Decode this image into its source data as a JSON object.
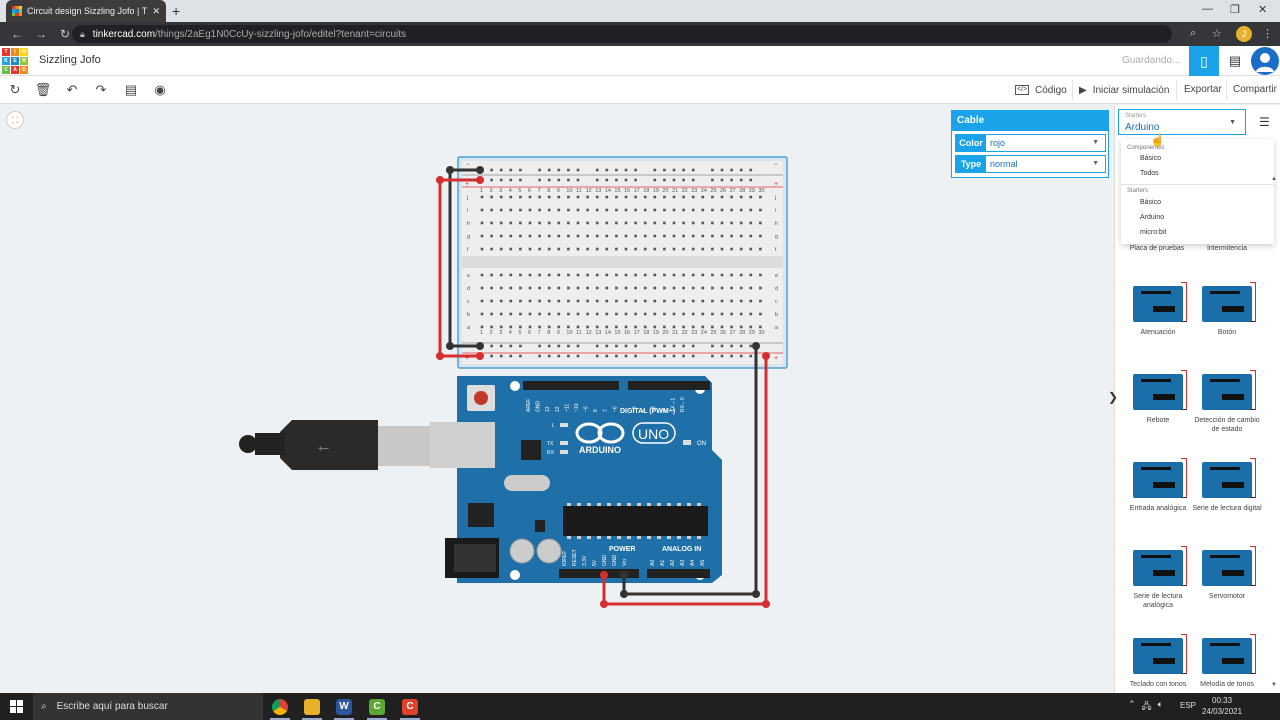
{
  "browser": {
    "tab_title": "Circuit design Sizzling Jofo | Tink",
    "tab_close": "✕",
    "new_tab": "+",
    "url_host": "tinkercad.com",
    "url_path": "/things/2aEg1N0CcUy-sizzling-jofo/editel?tenant=circuits",
    "profile_initial": "J"
  },
  "app": {
    "logo_letters": [
      "T",
      "I",
      "N",
      "K",
      "E",
      "R",
      "C",
      "A",
      "D"
    ],
    "logo_colors": [
      "#e5352c",
      "#f18a21",
      "#fbd41d",
      "#2aa1e0",
      "#1e8bc3",
      "#9ac33c",
      "#6ebd44",
      "#e5352c",
      "#f18a21"
    ],
    "design_name": "Sizzling Jofo",
    "saving_status": "Guardando..."
  },
  "toolbar": {
    "code_label": "Código",
    "simulate_label": "Iniciar simulación",
    "export_label": "Exportar",
    "share_label": "Compartir"
  },
  "inspector": {
    "title": "Cable",
    "color_label": "Color",
    "color_value": "rojo",
    "type_label": "Type",
    "type_value": "normal"
  },
  "panel": {
    "starters_small": "Starters",
    "starters_selected": "Arduino",
    "dropdown": {
      "group1": "Componentes",
      "group1_items": [
        "Básico",
        "Todos"
      ],
      "group2": "Starters",
      "group2_items": [
        "Básico",
        "Arduino",
        "micro:bit"
      ]
    },
    "partial_captions": [
      "Placa de pruebas",
      "Intermitencia"
    ],
    "components": [
      {
        "name": "Atenuación"
      },
      {
        "name": "Botón"
      },
      {
        "name": "Rebote"
      },
      {
        "name": "Detección de cambio de estado"
      },
      {
        "name": "Entrada analógica"
      },
      {
        "name": "Serie de lectura digital"
      },
      {
        "name": "Serie de lectura analógica"
      },
      {
        "name": "Servomotor"
      },
      {
        "name": "Teclado con tonos"
      },
      {
        "name": "Melodía de tonos"
      }
    ]
  },
  "board": {
    "digital_label": "DIGITAL (PWM~)",
    "arduino_label": "ARDUINO",
    "uno_label": "UNO",
    "power_label": "POWER",
    "analog_label": "ANALOG IN",
    "on_label": "ON",
    "l_label": "L",
    "tx_label": "TX",
    "rx_label": "RX",
    "digital_pins": [
      "AREF",
      "GND",
      "13",
      "12",
      "~11",
      "~10",
      "~9",
      "8",
      "7",
      "~6",
      "~5",
      "4",
      "~3",
      "2",
      "TX→1",
      "RX←0"
    ],
    "power_pins": [
      "IOREF",
      "RESET",
      "3.3V",
      "5V",
      "GND",
      "GND",
      "Vin"
    ],
    "analog_pins": [
      "A0",
      "A1",
      "A2",
      "A3",
      "A4",
      "A5"
    ]
  },
  "breadboard": {
    "row_letters_top": [
      "j",
      "i",
      "h",
      "g",
      "f"
    ],
    "row_letters_bottom": [
      "e",
      "d",
      "c",
      "b",
      "a"
    ],
    "col_numbers": [
      "1",
      "2",
      "3",
      "4",
      "5",
      "6",
      "7",
      "8",
      "9",
      "10",
      "11",
      "12",
      "13",
      "14",
      "15",
      "16",
      "17",
      "18",
      "19",
      "20",
      "21",
      "22",
      "23",
      "24",
      "25",
      "26",
      "27",
      "28",
      "29",
      "30"
    ],
    "minus": "−",
    "plus": "+"
  },
  "taskbar": {
    "search_placeholder": "Escribe aquí para buscar",
    "lang": "ESP",
    "time": "00:33",
    "date": "24/03/2021"
  }
}
